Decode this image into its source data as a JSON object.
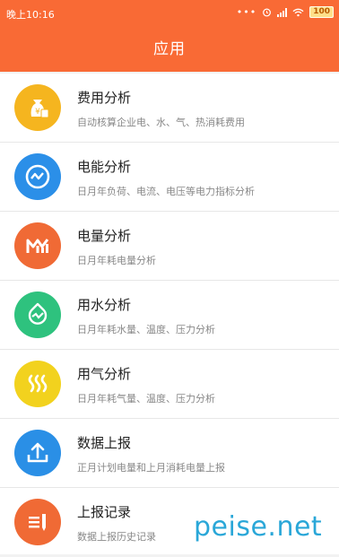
{
  "status_bar": {
    "time": "晚上10:16",
    "battery": "100"
  },
  "app_bar": {
    "title": "应用"
  },
  "items": [
    {
      "title": "费用分析",
      "desc": "自动核算企业电、水、气、热消耗费用",
      "icon": "money-bag-icon",
      "color": "#f5b51f"
    },
    {
      "title": "电能分析",
      "desc": "日月年负荷、电流、电压等电力指标分析",
      "icon": "pulse-chart-icon",
      "color": "#2b8fe8"
    },
    {
      "title": "电量分析",
      "desc": "日月年耗电量分析",
      "icon": "bar-chart-icon",
      "color": "#f06a35"
    },
    {
      "title": "用水分析",
      "desc": "日月年耗水量、温度、压力分析",
      "icon": "water-icon",
      "color": "#2ec27e"
    },
    {
      "title": "用气分析",
      "desc": "日月年耗气量、温度、压力分析",
      "icon": "gas-waves-icon",
      "color": "#f2d21e"
    },
    {
      "title": "数据上报",
      "desc": "正月计划电量和上月消耗电量上报",
      "icon": "upload-icon",
      "color": "#2a8fe6"
    },
    {
      "title": "上报记录",
      "desc": "数据上报历史记录",
      "icon": "record-list-icon",
      "color": "#f06a35"
    }
  ],
  "watermark": "peise.net"
}
